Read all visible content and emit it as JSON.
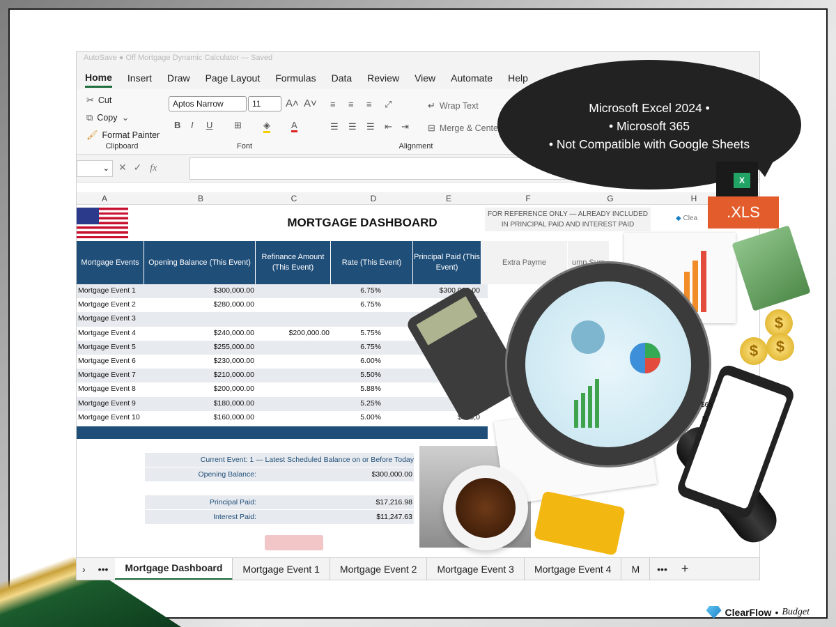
{
  "titlebar": {
    "text": "AutoSave  ● Off   Mortgage Dynamic Calculator — Saved"
  },
  "menu": [
    "Home",
    "Insert",
    "Draw",
    "Page Layout",
    "Formulas",
    "Data",
    "Review",
    "View",
    "Automate",
    "Help"
  ],
  "ribbon": {
    "clipboard": {
      "cut": "Cut",
      "copy": "Copy",
      "format_painter": "Format Painter",
      "group": "Clipboard"
    },
    "font": {
      "name": "Aptos Narrow",
      "size": "11",
      "group": "Font"
    },
    "alignment": {
      "wrap": "Wrap Text",
      "merge": "Merge & Center",
      "group": "Alignment"
    }
  },
  "formula": {
    "fx": "fx"
  },
  "columns": [
    "A",
    "B",
    "C",
    "D",
    "E",
    "F",
    "G",
    "H"
  ],
  "sheet": {
    "title": "MORTGAGE DASHBOARD",
    "ref_note": "FOR REFERENCE ONLY — ALREADY INCLUDED IN PRINCIPAL PAID AND INTEREST PAID",
    "brand_cell": "Clea",
    "headers": {
      "events": "Mortgage Events",
      "opening": "Opening Balance (This Event)",
      "refinance": "Refinance Amount (This Event)",
      "rate": "Rate (This Event)",
      "principal": "Principal Paid (This Event)",
      "extra": "Extra Payme",
      "lump": "ump Sum"
    },
    "rows": [
      {
        "event": "Mortgage Event 1",
        "opening": "$300,000.00",
        "refi": "",
        "rate": "6.75%",
        "principal": "$300,000.00"
      },
      {
        "event": "Mortgage Event 2",
        "opening": "$280,000.00",
        "refi": "",
        "rate": "6.75%",
        "principal": "$2"
      },
      {
        "event": "Mortgage Event 3",
        "opening": "",
        "refi": "",
        "rate": "",
        "principal": ""
      },
      {
        "event": "Mortgage Event 4",
        "opening": "$240,000.00",
        "refi": "$200,000.00",
        "rate": "5.75%",
        "principal": ""
      },
      {
        "event": "Mortgage Event 5",
        "opening": "$255,000.00",
        "refi": "",
        "rate": "6.75%",
        "principal": ""
      },
      {
        "event": "Mortgage Event 6",
        "opening": "$230,000.00",
        "refi": "",
        "rate": "6.00%",
        "principal": "$2"
      },
      {
        "event": "Mortgage Event 7",
        "opening": "$210,000.00",
        "refi": "",
        "rate": "5.50%",
        "principal": "$210,"
      },
      {
        "event": "Mortgage Event 8",
        "opening": "$200,000.00",
        "refi": "",
        "rate": "5.88%",
        "principal": "$200,000."
      },
      {
        "event": "Mortgage Event 9",
        "opening": "$180,000.00",
        "refi": "",
        "rate": "5.25%",
        "principal": "$"
      },
      {
        "event": "Mortgage Event 10",
        "opening": "$160,000.00",
        "refi": "",
        "rate": "5.00%",
        "principal": "$160,0"
      }
    ],
    "summary": {
      "current_event": "Current Event: 1 — Latest Scheduled Balance on or Before Today",
      "opening_label": "Opening Balance:",
      "opening_value": "$300,000.00",
      "principal_label": "Principal Paid:",
      "principal_value": "$17,216.98",
      "interest_label": "Interest Paid:",
      "interest_value": "$11,247.63"
    },
    "h_values": [
      "$65",
      "$"
    ]
  },
  "tabs": [
    "Mortgage Dashboard",
    "Mortgage Event 1",
    "Mortgage Event 2",
    "Mortgage Event 3",
    "Mortgage Event 4",
    "M"
  ],
  "overlay": {
    "bubble_line1": "Microsoft Excel 2024 •",
    "bubble_line2": "• Microsoft 365",
    "bubble_line3": "• Not Compatible with Google Sheets",
    "xls_tag": ".XLS",
    "xls_logo": "X"
  },
  "footer": {
    "brand": "ClearFlow",
    "sep": "•",
    "product": "Budget"
  },
  "colors": {
    "header_blue": "#1f4e79",
    "stripe": "#e7eaee",
    "excel_green": "#1e6d3d",
    "xls_orange": "#e35d2c"
  }
}
